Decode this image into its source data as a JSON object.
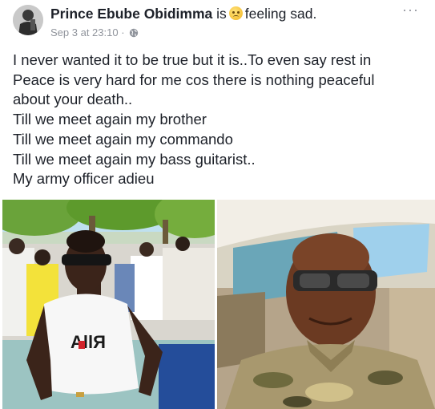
{
  "post": {
    "author": "Prince Ebube Obidimma",
    "verb": "is",
    "feeling_text": "feeling sad.",
    "feeling_icon": "sad-emoji-icon",
    "timestamp": "Sep 3 at 23:10",
    "separator": "·",
    "privacy_icon": "globe-icon",
    "more_label": "···",
    "lines": [
      "I never wanted it to be true but it is..To even say rest in",
      "Peace is very hard for me cos there is nothing peaceful",
      "about your death..",
      "Till we meet again my brother",
      "Till we  meet again my commando",
      "Till we meet again my bass guitarist..",
      "My army officer adieu"
    ],
    "photos": [
      {
        "name": "photo-young-man-sunglasses",
        "shirt_text": "AllЯ"
      },
      {
        "name": "photo-soldier-sunglasses"
      }
    ]
  },
  "colors": {
    "text": "#1d2129",
    "meta": "#90949c",
    "sky": "#9fd0ec",
    "tree": "#5d9a2c",
    "camo": "#a8986e"
  }
}
